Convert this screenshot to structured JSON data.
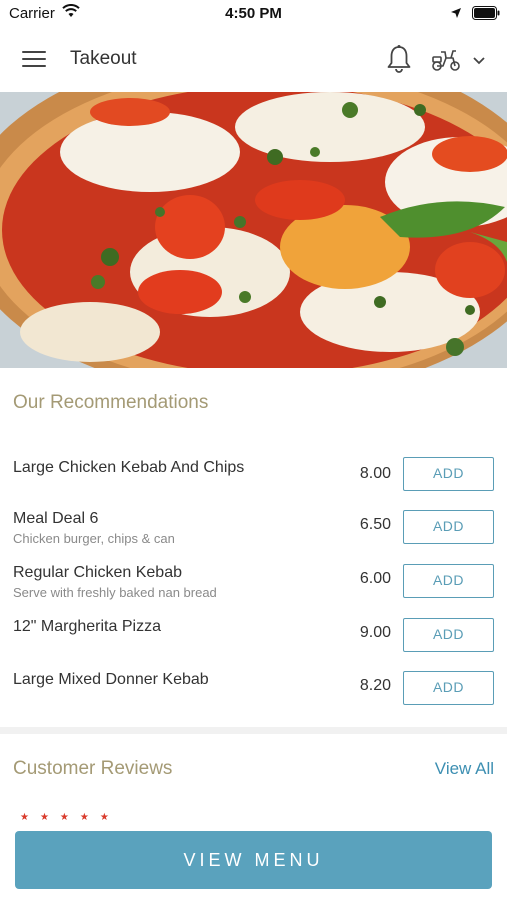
{
  "status_bar": {
    "carrier": "Carrier",
    "time": "4:50 PM"
  },
  "nav": {
    "title": "Takeout",
    "icons": [
      "menu-icon",
      "bell-icon",
      "scooter-icon",
      "chevron-down-icon"
    ]
  },
  "hero": {
    "icon": "pizza-photo"
  },
  "recommendations": {
    "title": "Our Recommendations",
    "add_label": "ADD",
    "items": [
      {
        "name": "Large Chicken Kebab And Chips",
        "description": "",
        "price": "8.00"
      },
      {
        "name": "Meal Deal 6",
        "description": "Chicken burger, chips & can",
        "price": "6.50"
      },
      {
        "name": "Regular Chicken Kebab",
        "description": "Serve with freshly baked nan bread",
        "price": "6.00"
      },
      {
        "name": "12\" Margherita Pizza",
        "description": "",
        "price": "9.00"
      },
      {
        "name": "Large Mixed Donner Kebab",
        "description": "",
        "price": "8.20"
      }
    ]
  },
  "reviews": {
    "title": "Customer Reviews",
    "view_all": "View All",
    "stars": "★★★★★"
  },
  "footer": {
    "view_menu": "VIEW MENU"
  },
  "colors": {
    "accent": "#5aa2bd",
    "section_title": "#a49a75",
    "link": "#3d8fb2",
    "star": "#d93a2b"
  }
}
